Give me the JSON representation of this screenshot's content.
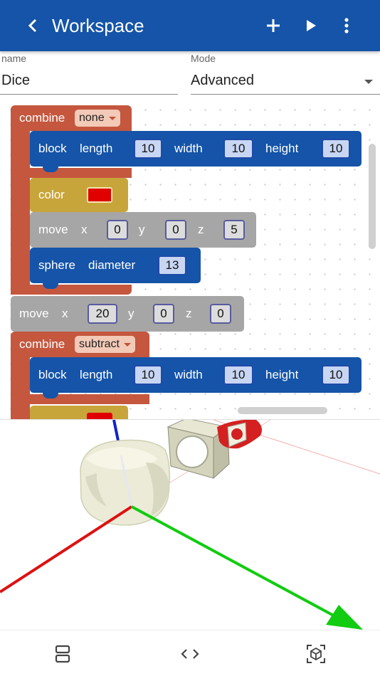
{
  "app_bar": {
    "title": "Workspace",
    "icons": [
      "chevron-left-icon",
      "plus-icon",
      "play-icon",
      "more-vert-icon"
    ],
    "color": "#1554a8"
  },
  "form": {
    "name_label": "name",
    "name_value": "Dice",
    "mode_label": "Mode",
    "mode_value": "Advanced"
  },
  "blocks": {
    "combine1": {
      "label": "combine",
      "op": "none"
    },
    "block1": {
      "label": "block",
      "length_label": "length",
      "length": "10",
      "width_label": "width",
      "width": "10",
      "height_label": "height",
      "height": "10"
    },
    "color1": {
      "label": "color",
      "swatch": "#e00000"
    },
    "move1": {
      "label": "move",
      "x_label": "x",
      "x": "0",
      "y_label": "y",
      "y": "0",
      "z_label": "z",
      "z": "5"
    },
    "sphere1": {
      "label": "sphere",
      "diameter_label": "diameter",
      "diameter": "13"
    },
    "move2": {
      "label": "move",
      "x_label": "x",
      "x": "20",
      "y_label": "y",
      "y": "0",
      "z_label": "z",
      "z": "0"
    },
    "combine2": {
      "label": "combine",
      "op": "subtract"
    },
    "block2": {
      "label": "block",
      "length_label": "length",
      "length": "10",
      "width_label": "width",
      "width": "10",
      "height_label": "height",
      "height": "10"
    }
  },
  "block_colors": {
    "combine": "#c4573e",
    "block": "#1554a8",
    "color": "#c8a53a",
    "move": "#a6a6a6"
  },
  "viewer": {
    "axis_colors": {
      "x": "#dd1111",
      "y": "#11cc11",
      "z": "#1122cc"
    }
  },
  "bottom_nav": {
    "icons": [
      "view-split-icon",
      "code-icon",
      "3d-view-icon"
    ]
  }
}
